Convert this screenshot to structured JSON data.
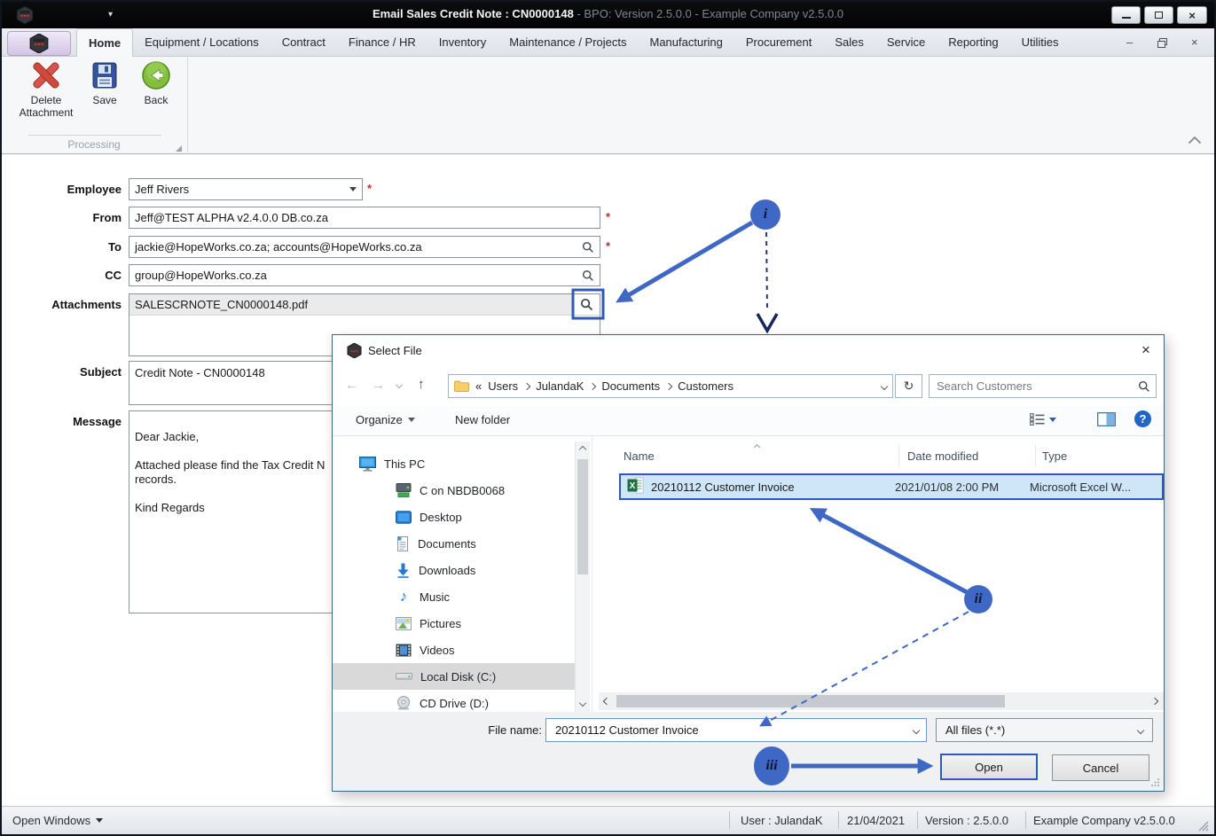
{
  "window": {
    "title_primary": "Email Sales Credit Note : CN0000148",
    "title_secondary": " - BPO: Version 2.5.0.0 - Example Company v2.5.0.0"
  },
  "ribbon": {
    "tabs": [
      "Home",
      "Equipment / Locations",
      "Contract",
      "Finance / HR",
      "Inventory",
      "Maintenance / Projects",
      "Manufacturing",
      "Procurement",
      "Sales",
      "Service",
      "Reporting",
      "Utilities"
    ],
    "buttons": {
      "delete": {
        "label": "Delete Attachment"
      },
      "save": {
        "label": "Save"
      },
      "back": {
        "label": "Back"
      }
    },
    "group_label": "Processing"
  },
  "form": {
    "required_marker": "*",
    "employee": {
      "label": "Employee",
      "value": "Jeff Rivers"
    },
    "from": {
      "label": "From",
      "value": "Jeff@TEST ALPHA v2.4.0.0 DB.co.za"
    },
    "to": {
      "label": "To",
      "value": "jackie@HopeWorks.co.za; accounts@HopeWorks.co.za"
    },
    "cc": {
      "label": "CC",
      "value": "group@HopeWorks.co.za"
    },
    "attachments": {
      "label": "Attachments",
      "value": "SALESCRNOTE_CN0000148.pdf"
    },
    "subject": {
      "label": "Subject",
      "value": "Credit Note - CN0000148"
    },
    "message": {
      "label": "Message",
      "value": "Dear Jackie,\n\nAttached please find the Tax Credit N\nrecords.\n\nKind Regards"
    }
  },
  "dialog": {
    "title": "Select File",
    "nav": {
      "breadcrumb_prefix": "«",
      "crumbs": [
        "Users",
        "JulandaK",
        "Documents",
        "Customers"
      ]
    },
    "search_placeholder": "Search Customers",
    "toolbar": {
      "organize": "Organize",
      "new_folder": "New folder"
    },
    "sidebar": [
      {
        "label": "This PC",
        "icon": "this-pc-icon"
      },
      {
        "label": "C on NBDB0068",
        "icon": "network-drive-icon"
      },
      {
        "label": "Desktop",
        "icon": "desktop-icon"
      },
      {
        "label": "Documents",
        "icon": "documents-icon"
      },
      {
        "label": "Downloads",
        "icon": "downloads-icon"
      },
      {
        "label": "Music",
        "icon": "music-icon"
      },
      {
        "label": "Pictures",
        "icon": "pictures-icon"
      },
      {
        "label": "Videos",
        "icon": "videos-icon"
      },
      {
        "label": "Local Disk (C:)",
        "icon": "local-disk-icon",
        "selected": true
      },
      {
        "label": "CD Drive (D:)",
        "icon": "cd-drive-icon"
      }
    ],
    "columns": [
      "Name",
      "Date modified",
      "Type"
    ],
    "files": [
      {
        "name": "20210112 Customer Invoice",
        "date_modified": "2021/01/08 2:00 PM",
        "type": "Microsoft Excel W...",
        "icon": "excel-file-icon",
        "selected": true
      }
    ],
    "file_name": {
      "label": "File name:",
      "value": "20210112 Customer Invoice"
    },
    "file_type_value": "All files (*.*)",
    "open_label": "Open",
    "cancel_label": "Cancel"
  },
  "status_bar": {
    "open_windows": "Open Windows",
    "user": "User : JulandaK",
    "date": "21/04/2021",
    "version": "Version : 2.5.0.0",
    "company": "Example Company v2.5.0.0"
  },
  "annotations": {
    "step1": "i",
    "step2": "ii",
    "step3": "iii"
  },
  "icons": {
    "close": "×",
    "back_arrow": "←",
    "forward_arrow": "→",
    "up_arrow": "↑",
    "refresh": "↻",
    "help": "?",
    "music_note": "♪",
    "caret_down": "▾"
  },
  "colors": {
    "annotation_blue": "#3f68c5",
    "selection_border": "#2f5bb7",
    "selection_fill": "#cfe5f8",
    "required_red": "#c42b2b",
    "titlebar": "#060708"
  }
}
